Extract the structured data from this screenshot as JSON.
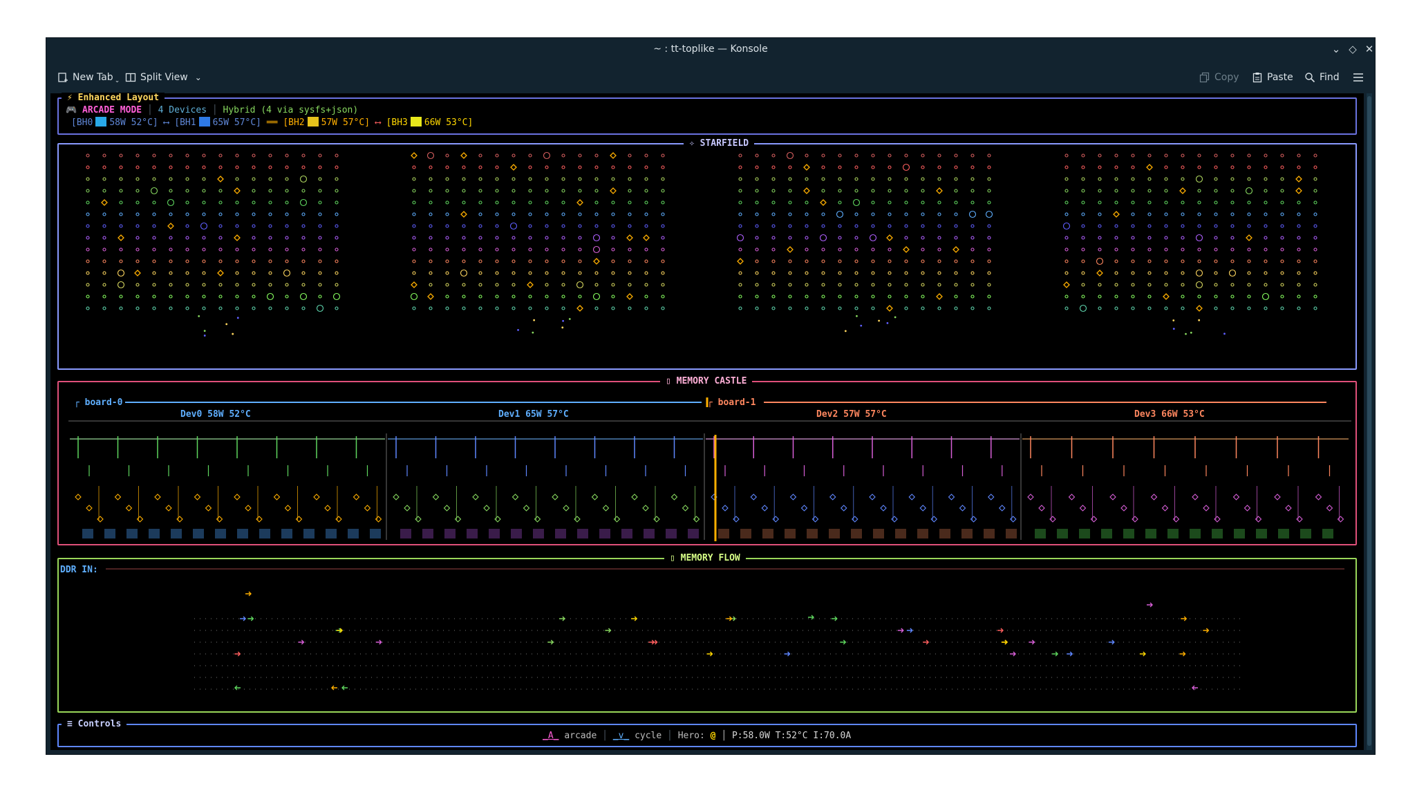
{
  "window": {
    "title": "~ : tt-toplike — Konsole"
  },
  "toolbar": {
    "new_tab": "New Tab",
    "split_view": "Split View",
    "copy": "Copy",
    "paste": "Paste",
    "find": "Find"
  },
  "header": {
    "title": "Enhanced Layout",
    "mode": "ARCADE MODE",
    "devices": "4 Devices",
    "backend": "Hybrid (4 via sysfs+json)",
    "bh0": "[BH0",
    "bh0_stats": "58W 52°C]",
    "bh1": "[BH1",
    "bh1_stats": "65W 57°C]",
    "bh2": "[BH2",
    "bh2_stats": "57W 57°C]",
    "bh3": "[BH3",
    "bh3_stats": "66W 53°C]",
    "bh0_color": "#29a9e8",
    "bh1_color": "#2e7ae6",
    "bh2_color": "#e6c31c",
    "bh3_color": "#e8e81c"
  },
  "starfield": {
    "title": "✧ STARFIELD"
  },
  "castle": {
    "title": "MEMORY CASTLE",
    "board0": "board-0",
    "board1": "board-1",
    "dev0": "Dev0 58W 52°C",
    "dev1": "Dev1 65W 57°C",
    "dev2": "Dev2 57W 57°C",
    "dev3": "Dev3 66W 53°C"
  },
  "flow": {
    "title": "MEMORY FLOW",
    "ddr_label": "DDR IN:"
  },
  "controls": {
    "title": "Controls",
    "key_a": "A",
    "arcade": "arcade",
    "key_v": "v",
    "cycle": "cycle",
    "hero_label": "Hero:",
    "hero_glyph": "@",
    "stats": "P:58.0W T:52°C I:70.0A"
  }
}
